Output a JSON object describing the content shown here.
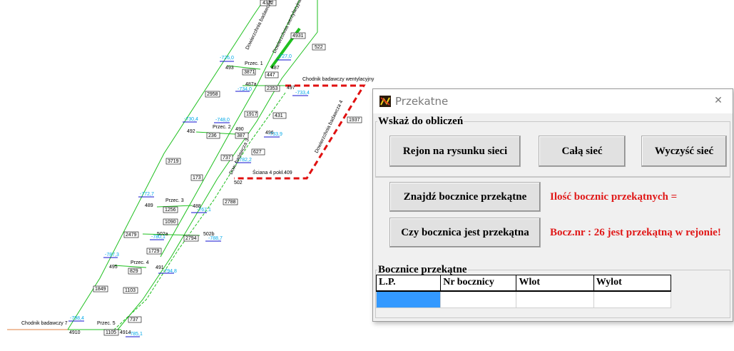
{
  "network": {
    "labels": {
      "dowierzchnia1": "Dowierzchnia badawcza 1",
      "wentylacyjna": "Dowierzchnia wentylacyjna",
      "chodnik_wentylacyjny": "Chodnik badawczy wentylacyjny",
      "dowierzchnia4": "Dowierzchnia badawcza 4",
      "sciana": "Ściana 4 pokł.409",
      "chodnik_badawczy7": "Chodnik badawczy 7",
      "przec1": "Przec. 1",
      "przec2": "Przec. 2",
      "przec3": "Przec. 3",
      "przec4": "Przec. 4",
      "przec5": "Przec. 5",
      "dow_badawcza_mid": "Dow. badawcza 3"
    },
    "nodes": [
      "4372",
      "4931",
      "522",
      "493",
      "487",
      "3871",
      "447",
      "487a",
      "497",
      "2353",
      "2958",
      "1917",
      "431",
      "492",
      "490",
      "496",
      "236",
      "387",
      "3719",
      "627",
      "737",
      "173",
      "502",
      "1937",
      "489",
      "488",
      "1256",
      "2788",
      "1090",
      "2479",
      "502a",
      "502b",
      "1729",
      "2794",
      "495",
      "491",
      "829",
      "1849",
      "1103",
      "737",
      "4910",
      "1105",
      "4914"
    ],
    "pressures": [
      "-726,0",
      "-727,0",
      "-734,0",
      "-733,4",
      "-730,4",
      "-748,0",
      "-733,9",
      "-782,2",
      "-772,7",
      "-767,1",
      "-788,7",
      "-787,3",
      "-794,8",
      "-798,4",
      "-785,1",
      "-780,1"
    ]
  },
  "dialog": {
    "title": "Przekatne",
    "close_glyph": "✕",
    "section_select": "Wskaż do obliczeń",
    "btn_area": "Rejon na rysunku sieci",
    "btn_whole": "Całą sieć",
    "btn_clear": "Wyczyść sieć",
    "btn_find": "Znajdź bocznice przekątne",
    "result_count": "Ilość bocznic przekątnych =",
    "btn_check": "Czy bocznica jest przekątna",
    "result_check": "Bocz.nr : 26 jest przekątną w rejonie!",
    "section_list": "Bocznice przekątne",
    "columns": [
      "L.P.",
      "Nr bocznicy",
      "Wlot",
      "Wylot"
    ]
  },
  "colors": {
    "network_green": "#1fc01f",
    "diagonal_red": "#e01010",
    "pressure_blue": "#00a8e8",
    "result_red": "#e01818",
    "selection": "#3399ff"
  }
}
